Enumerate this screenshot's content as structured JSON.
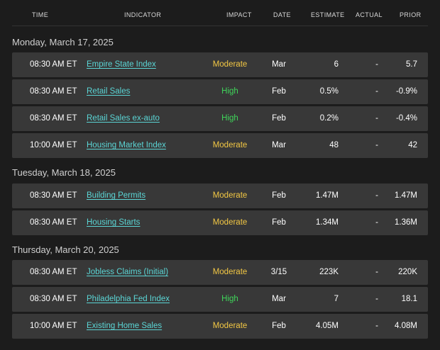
{
  "columns": {
    "time": "TIME",
    "indicator": "INDICATOR",
    "impact": "IMPACT",
    "date": "DATE",
    "estimate": "ESTIMATE",
    "actual": "ACTUAL",
    "prior": "PRIOR"
  },
  "colors": {
    "moderate": "#f2c744",
    "high": "#3fd65a",
    "link": "#5bd6d6",
    "row_bg": "#383838",
    "page_bg": "#1c1c1c"
  },
  "days": [
    {
      "label": "Monday, March 17, 2025",
      "events": [
        {
          "time": "08:30 AM ET",
          "indicator": "Empire State Index",
          "impact": "Moderate",
          "date": "Mar",
          "estimate": "6",
          "actual": "-",
          "prior": "5.7"
        },
        {
          "time": "08:30 AM ET",
          "indicator": "Retail Sales",
          "impact": "High",
          "date": "Feb",
          "estimate": "0.5%",
          "actual": "-",
          "prior": "-0.9%"
        },
        {
          "time": "08:30 AM ET",
          "indicator": "Retail Sales ex-auto",
          "impact": "High",
          "date": "Feb",
          "estimate": "0.2%",
          "actual": "-",
          "prior": "-0.4%"
        },
        {
          "time": "10:00 AM ET",
          "indicator": "Housing Market Index",
          "impact": "Moderate",
          "date": "Mar",
          "estimate": "48",
          "actual": "-",
          "prior": "42"
        }
      ]
    },
    {
      "label": "Tuesday, March 18, 2025",
      "events": [
        {
          "time": "08:30 AM ET",
          "indicator": "Building Permits",
          "impact": "Moderate",
          "date": "Feb",
          "estimate": "1.47M",
          "actual": "-",
          "prior": "1.47M"
        },
        {
          "time": "08:30 AM ET",
          "indicator": "Housing Starts",
          "impact": "Moderate",
          "date": "Feb",
          "estimate": "1.34M",
          "actual": "-",
          "prior": "1.36M"
        }
      ]
    },
    {
      "label": "Thursday, March 20, 2025",
      "events": [
        {
          "time": "08:30 AM ET",
          "indicator": "Jobless Claims (Initial)",
          "impact": "Moderate",
          "date": "3/15",
          "estimate": "223K",
          "actual": "-",
          "prior": "220K"
        },
        {
          "time": "08:30 AM ET",
          "indicator": "Philadelphia Fed Index",
          "impact": "High",
          "date": "Mar",
          "estimate": "7",
          "actual": "-",
          "prior": "18.1"
        },
        {
          "time": "10:00 AM ET",
          "indicator": "Existing Home Sales",
          "impact": "Moderate",
          "date": "Feb",
          "estimate": "4.05M",
          "actual": "-",
          "prior": "4.08M"
        }
      ]
    }
  ]
}
